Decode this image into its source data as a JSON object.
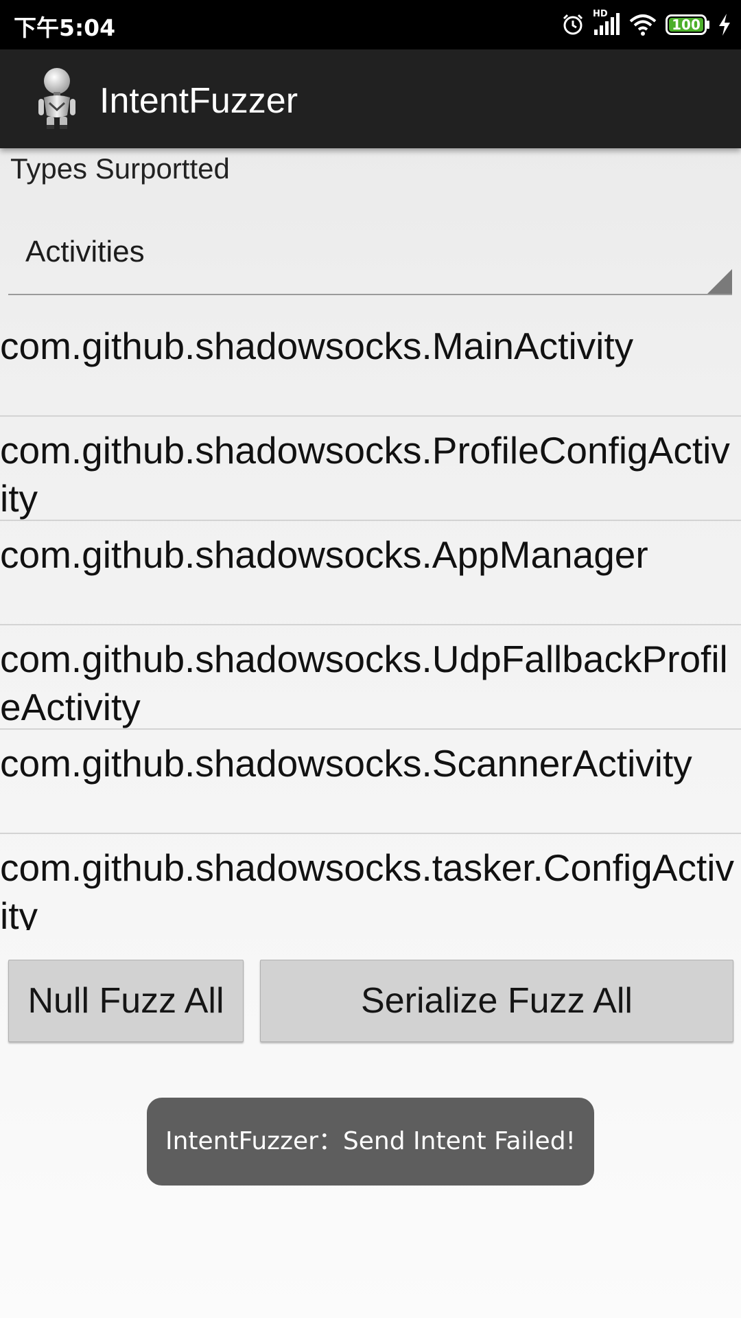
{
  "status_bar": {
    "time": "下午5:04",
    "network_label": "HD",
    "battery_level": "100",
    "icons": [
      "alarm-icon",
      "signal-icon",
      "wifi-icon",
      "battery-icon",
      "charging-icon"
    ]
  },
  "action_bar": {
    "title": "IntentFuzzer",
    "icon": "android-robot-icon"
  },
  "types": {
    "label": "Types Surportted",
    "selected": "Activities"
  },
  "components": [
    "com.github.shadowsocks.MainActivity",
    "com.github.shadowsocks.ProfileConfigActivity",
    "com.github.shadowsocks.AppManager",
    "com.github.shadowsocks.UdpFallbackProfileActivity",
    "com.github.shadowsocks.ScannerActivity",
    "com.github.shadowsocks.tasker.ConfigActivity"
  ],
  "buttons": {
    "null_fuzz": "Null Fuzz All",
    "serialize_fuzz": "Serialize Fuzz All"
  },
  "toast": {
    "message": "IntentFuzzer：Send Intent Failed!"
  },
  "colors": {
    "status_bar": "#000000",
    "action_bar": "#212121",
    "battery_fill": "#4caf2a",
    "toast_bg": "#5e5e5e"
  }
}
